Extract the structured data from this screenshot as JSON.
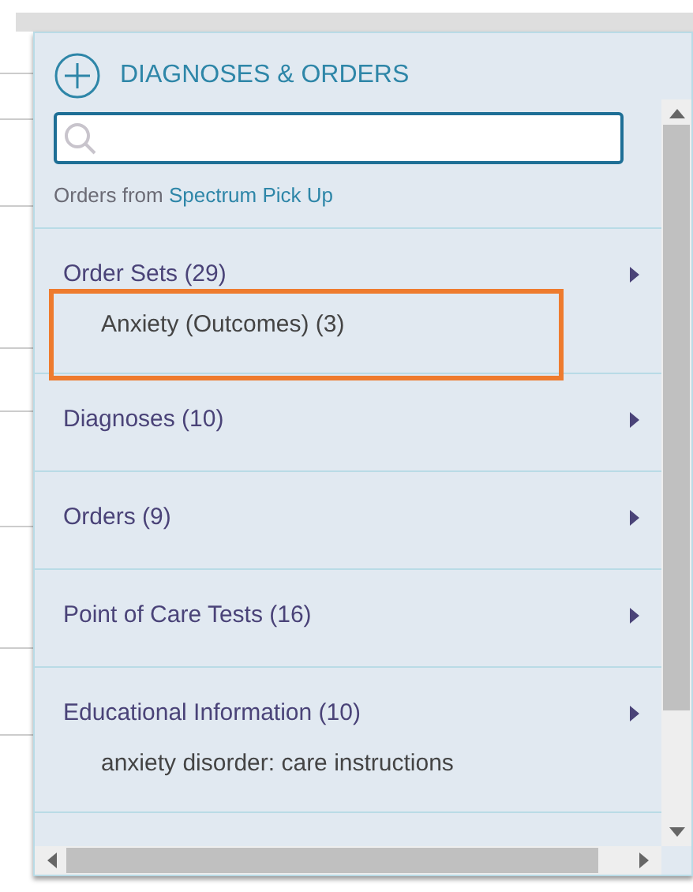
{
  "panel": {
    "title": "DIAGNOSES & ORDERS",
    "source_label": "Orders from",
    "source_link": "Spectrum Pick Up"
  },
  "sections": [
    {
      "label": "Order Sets (29)",
      "items": [
        "Anxiety (Outcomes) (3)"
      ],
      "highlighted": true
    },
    {
      "label": "Diagnoses (10)",
      "highlighted": false
    },
    {
      "label": "Orders (9)",
      "highlighted": false
    },
    {
      "label": "Point of Care Tests (16)",
      "highlighted": false
    },
    {
      "label": "Educational Information (10)",
      "items": [
        "anxiety disorder: care instructions"
      ],
      "highlighted": false
    }
  ]
}
